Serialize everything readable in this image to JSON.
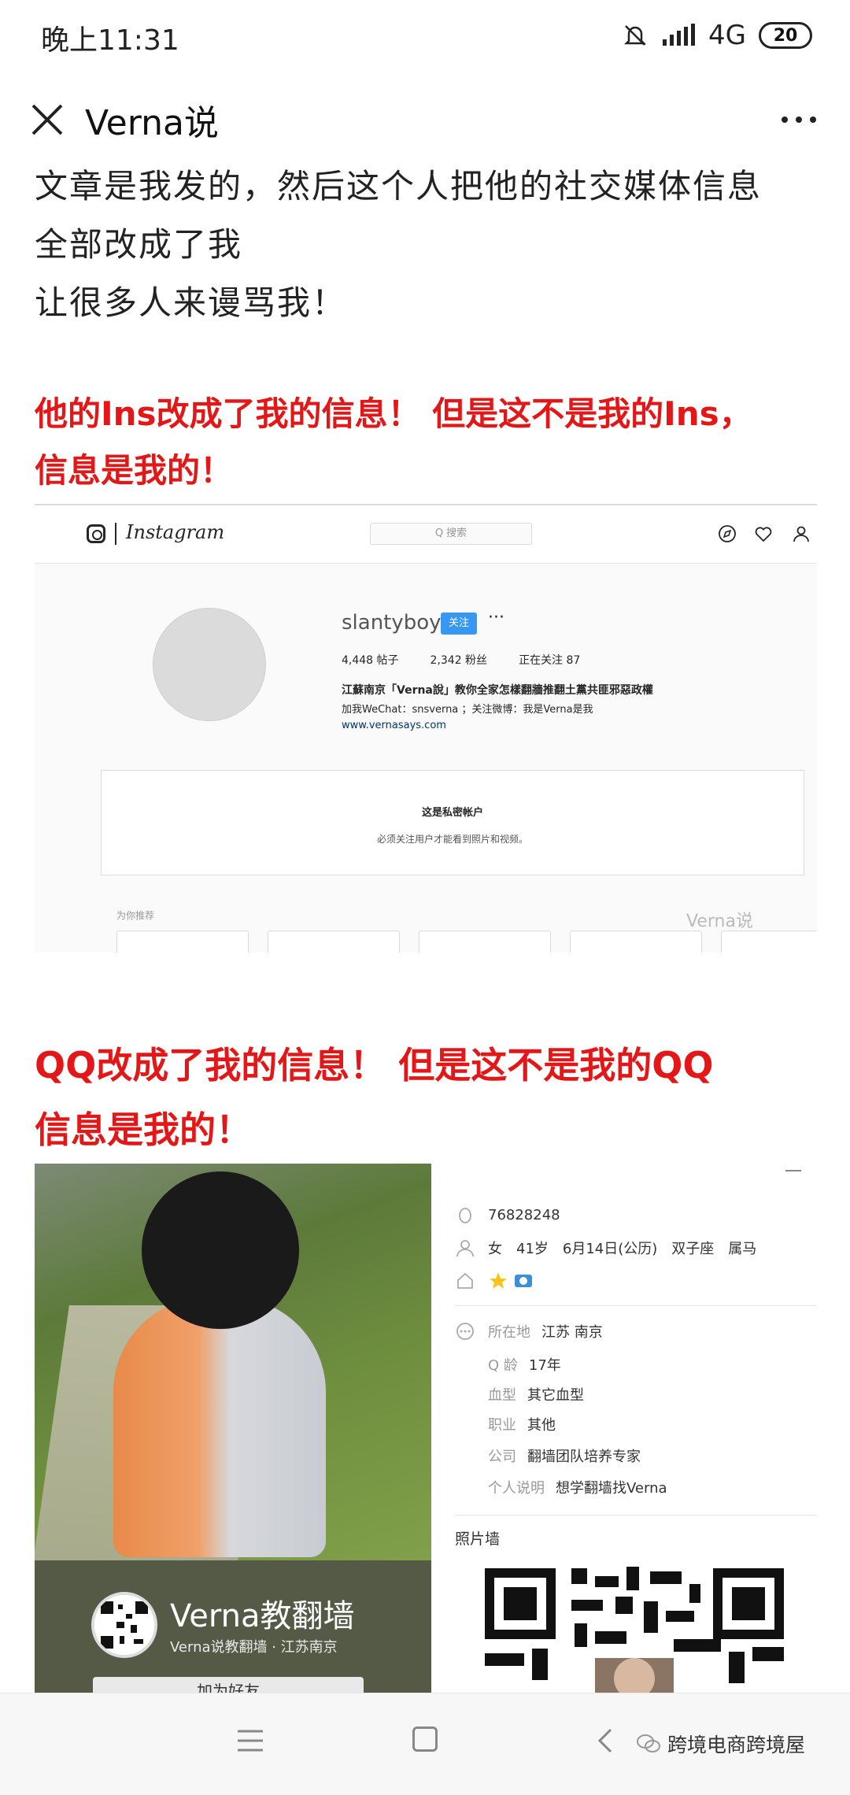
{
  "status_bar": {
    "time": "晚上11:31",
    "network": "4G",
    "battery": "20"
  },
  "title_bar": {
    "title": "Verna说",
    "close_icon": "close-icon",
    "more_icon": "more-icon"
  },
  "article": {
    "para_line1": "文章是我发的，然后这个人把他的社交媒体信息",
    "para_line2": "全部改成了我",
    "para_line3": "让很多人来谩骂我！",
    "ins_heading_line1": "他的Ins改成了我的信息！ 但是这不是我的Ins，",
    "ins_heading_line2": "信息是我的！",
    "qq_heading_line1": "QQ改成了我的信息！ 但是这不是我的QQ",
    "qq_heading_line2": "信息是我的！"
  },
  "instagram": {
    "wordmark": "Instagram",
    "search_placeholder": "Q 搜索",
    "username": "slantyboy",
    "follow_label": "关注",
    "more": "···",
    "posts": "4,448 帖子",
    "followers": "2,342 粉丝",
    "following": "正在关注 87",
    "bio_line1": "江蘇南京「Verna說」教你全家怎樣翻牆推翻土黨共匪邪惡政權",
    "bio_line2": "加我WeChat：snsverna ；关注微博：我是Verna是我",
    "link": "www.vernasays.com",
    "private_title": "这是私密帐户",
    "private_sub": "必须关注用户才能看到照片和视频。",
    "suggest_label": "为你推荐",
    "watermark": "Verna说"
  },
  "qq": {
    "number": "76828248",
    "gender_age": "女　41岁　6月14日(公历)　双子座　属马",
    "location_label": "所在地",
    "location_value": "江苏 南京",
    "qage_label": "Q 龄",
    "qage_value": "17年",
    "blood_label": "血型",
    "blood_value": "其它血型",
    "job_label": "职业",
    "job_value": "其他",
    "company_label": "公司",
    "company_value": "翻墙团队培养专家",
    "desc_label": "个人说明",
    "desc_value": "想学翻墙找Verna",
    "photo_wall": "照片墙",
    "card_name": "Verna教翻墙",
    "card_sub": "Verna说教翻墙 · 江苏南京",
    "add_friend": "加为好友"
  },
  "nav_bar": {
    "watermark": "跨境电商跨境屋"
  },
  "colors": {
    "accent_red": "#e31717",
    "ig_blue": "#3897f0",
    "qq_card_bg": "#545a45"
  }
}
